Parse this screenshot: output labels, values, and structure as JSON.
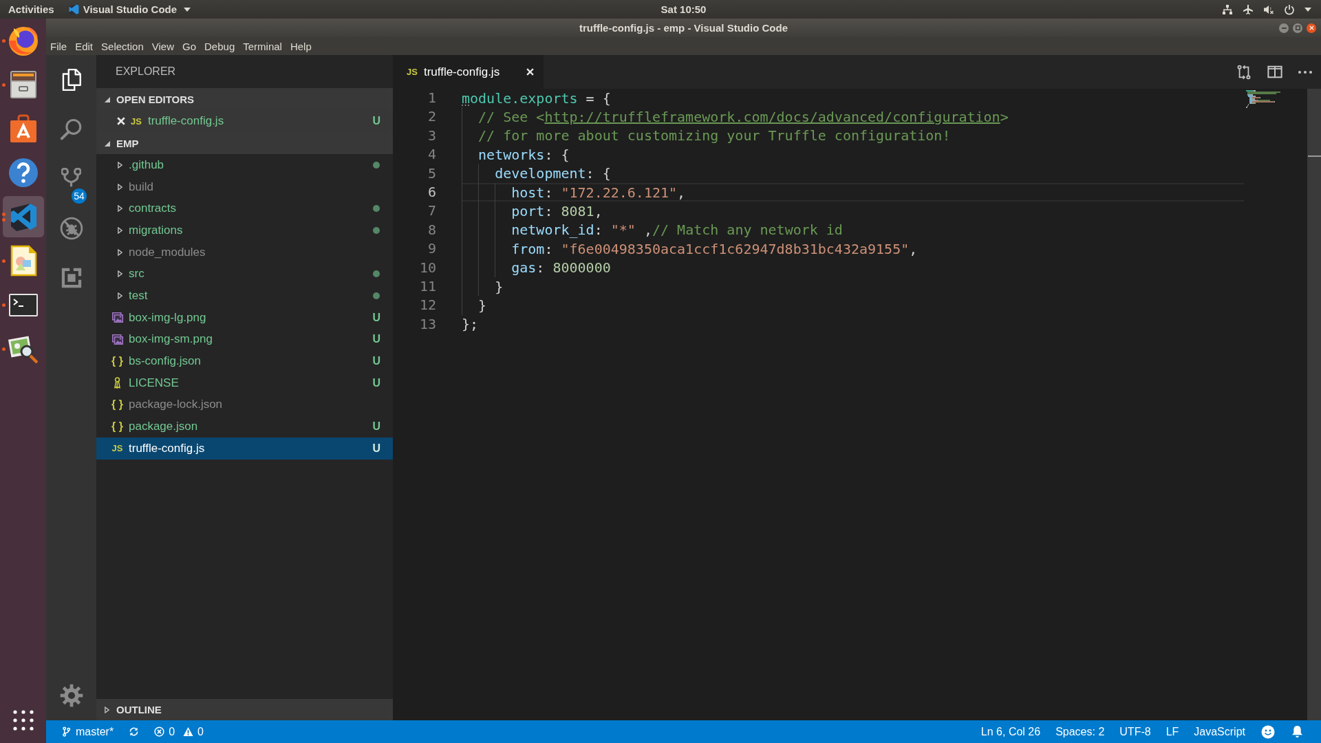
{
  "top_bar": {
    "activities": "Activities",
    "app_menu": "Visual Studio Code",
    "clock": "Sat 10:50"
  },
  "dock": {
    "apps": [
      {
        "kind": "globe",
        "running": true,
        "multiple": false,
        "selected": false
      },
      {
        "kind": "cabinet",
        "running": true,
        "multiple": false,
        "selected": false
      },
      {
        "kind": "bag",
        "running": false,
        "multiple": false,
        "selected": false
      },
      {
        "kind": "help",
        "running": false,
        "multiple": false,
        "selected": false
      },
      {
        "kind": "editor",
        "running": true,
        "multiple": true,
        "selected": true
      },
      {
        "kind": "drawing",
        "running": true,
        "multiple": false,
        "selected": false
      },
      {
        "kind": "terminal",
        "running": true,
        "multiple": false,
        "selected": false
      },
      {
        "kind": "viewer",
        "running": true,
        "multiple": false,
        "selected": false
      }
    ]
  },
  "window": {
    "title": "truffle-config.js - emp - Visual Studio Code"
  },
  "menu": [
    "File",
    "Edit",
    "Selection",
    "View",
    "Go",
    "Debug",
    "Terminal",
    "Help"
  ],
  "activity_bar": {
    "items": [
      {
        "kind": "explorer",
        "selected": true
      },
      {
        "kind": "search",
        "selected": false
      },
      {
        "kind": "scm",
        "selected": false,
        "badge": "54"
      },
      {
        "kind": "debug",
        "selected": false
      },
      {
        "kind": "extensions",
        "selected": false
      }
    ]
  },
  "sidebar": {
    "title": "EXPLORER",
    "open_editors": {
      "title": "OPEN EDITORS",
      "expanded": true,
      "items": [
        {
          "kind": "js",
          "icon_text": "JS",
          "name": "truffle-config.js",
          "ignored": false,
          "badge": "U"
        }
      ]
    },
    "workspace": {
      "title": "EMP",
      "expanded": true,
      "items": [
        {
          "kind": "folder",
          "name": ".github",
          "ignored": false,
          "expanded": false,
          "dot": true,
          "selected": false
        },
        {
          "kind": "folder",
          "name": "build",
          "ignored": true,
          "expanded": false,
          "dot": false,
          "selected": false
        },
        {
          "kind": "folder",
          "name": "contracts",
          "ignored": false,
          "expanded": false,
          "dot": true,
          "selected": false
        },
        {
          "kind": "folder",
          "name": "migrations",
          "ignored": false,
          "expanded": false,
          "dot": true,
          "selected": false
        },
        {
          "kind": "folder",
          "name": "node_modules",
          "ignored": true,
          "expanded": false,
          "dot": false,
          "selected": false
        },
        {
          "kind": "folder",
          "name": "src",
          "ignored": false,
          "expanded": false,
          "dot": true,
          "selected": false
        },
        {
          "kind": "folder",
          "name": "test",
          "ignored": false,
          "expanded": false,
          "dot": true,
          "selected": false
        },
        {
          "kind": "image",
          "name": "box-img-lg.png",
          "ignored": false,
          "badge": "U",
          "dot": false,
          "selected": false
        },
        {
          "kind": "image",
          "name": "box-img-sm.png",
          "ignored": false,
          "badge": "U",
          "dot": false,
          "selected": false
        },
        {
          "kind": "json",
          "icon_text": "{ }",
          "name": "bs-config.json",
          "ignored": false,
          "badge": "U",
          "dot": false,
          "selected": false
        },
        {
          "kind": "license",
          "name": "LICENSE",
          "ignored": false,
          "badge": "U",
          "dot": false,
          "selected": false
        },
        {
          "kind": "json",
          "icon_text": "{ }",
          "name": "package-lock.json",
          "ignored": true,
          "dot": false,
          "selected": false
        },
        {
          "kind": "json",
          "icon_text": "{ }",
          "name": "package.json",
          "ignored": false,
          "badge": "U",
          "dot": false,
          "selected": false
        },
        {
          "kind": "js",
          "icon_text": "JS",
          "name": "truffle-config.js",
          "ignored": false,
          "badge": "U",
          "dot": false,
          "selected": true
        }
      ]
    },
    "outline": {
      "title": "OUTLINE",
      "expanded": false
    }
  },
  "editor": {
    "tabs": [
      {
        "kind": "js",
        "icon_text": "JS",
        "label": "truffle-config.js",
        "selected": true
      }
    ],
    "lines": [
      {
        "number": "1",
        "current": false,
        "hint": true,
        "tokens": [
          {
            "kind": "var",
            "t": "module.exports"
          },
          {
            "kind": "punct",
            "t": " = {"
          }
        ]
      },
      {
        "number": "2",
        "current": false,
        "hint": false,
        "tokens": [
          {
            "kind": "comment",
            "t": "  // See <"
          },
          {
            "kind": "link",
            "t": "http://truffleframework.com/docs/advanced/configuration"
          },
          {
            "kind": "comment",
            "t": ">"
          }
        ]
      },
      {
        "number": "3",
        "current": false,
        "hint": false,
        "tokens": [
          {
            "kind": "comment",
            "t": "  // for more about customizing your Truffle configuration!"
          }
        ]
      },
      {
        "number": "4",
        "current": false,
        "hint": false,
        "tokens": [
          {
            "kind": "prop",
            "t": "  networks"
          },
          {
            "kind": "punct",
            "t": ": {"
          }
        ]
      },
      {
        "number": "5",
        "current": false,
        "hint": false,
        "tokens": [
          {
            "kind": "prop",
            "t": "    development"
          },
          {
            "kind": "punct",
            "t": ": {"
          }
        ]
      },
      {
        "number": "6",
        "current": true,
        "hint": false,
        "tokens": [
          {
            "kind": "prop",
            "t": "      host"
          },
          {
            "kind": "punct",
            "t": ": "
          },
          {
            "kind": "string",
            "t": "\"172.22.6.121\""
          },
          {
            "kind": "punct",
            "t": ","
          }
        ]
      },
      {
        "number": "7",
        "current": false,
        "hint": false,
        "tokens": [
          {
            "kind": "prop",
            "t": "      port"
          },
          {
            "kind": "punct",
            "t": ": "
          },
          {
            "kind": "number",
            "t": "8081"
          },
          {
            "kind": "punct",
            "t": ","
          }
        ]
      },
      {
        "number": "8",
        "current": false,
        "hint": false,
        "tokens": [
          {
            "kind": "prop",
            "t": "      network_id"
          },
          {
            "kind": "punct",
            "t": ": "
          },
          {
            "kind": "string",
            "t": "\"*\""
          },
          {
            "kind": "punct",
            "t": " ,"
          },
          {
            "kind": "comment",
            "t": "// Match any network id"
          }
        ]
      },
      {
        "number": "9",
        "current": false,
        "hint": false,
        "tokens": [
          {
            "kind": "prop",
            "t": "      from"
          },
          {
            "kind": "punct",
            "t": ": "
          },
          {
            "kind": "string",
            "t": "\"f6e00498350aca1ccf1c62947d8b31bc432a9155\""
          },
          {
            "kind": "punct",
            "t": ","
          }
        ]
      },
      {
        "number": "10",
        "current": false,
        "hint": false,
        "tokens": [
          {
            "kind": "prop",
            "t": "      gas"
          },
          {
            "kind": "punct",
            "t": ": "
          },
          {
            "kind": "number",
            "t": "8000000"
          }
        ]
      },
      {
        "number": "11",
        "current": false,
        "hint": false,
        "tokens": [
          {
            "kind": "punct",
            "t": "    }"
          }
        ]
      },
      {
        "number": "12",
        "current": false,
        "hint": false,
        "tokens": [
          {
            "kind": "punct",
            "t": "  }"
          }
        ]
      },
      {
        "number": "13",
        "current": false,
        "hint": false,
        "tokens": [
          {
            "kind": "punct",
            "t": "};"
          }
        ]
      }
    ]
  },
  "status_bar": {
    "branch": "master*",
    "errors": "0",
    "warnings": "0",
    "cursor": "Ln 6, Col 26",
    "indentation": "Spaces: 2",
    "encoding": "UTF-8",
    "line_ending": "LF",
    "language": "JavaScript"
  }
}
